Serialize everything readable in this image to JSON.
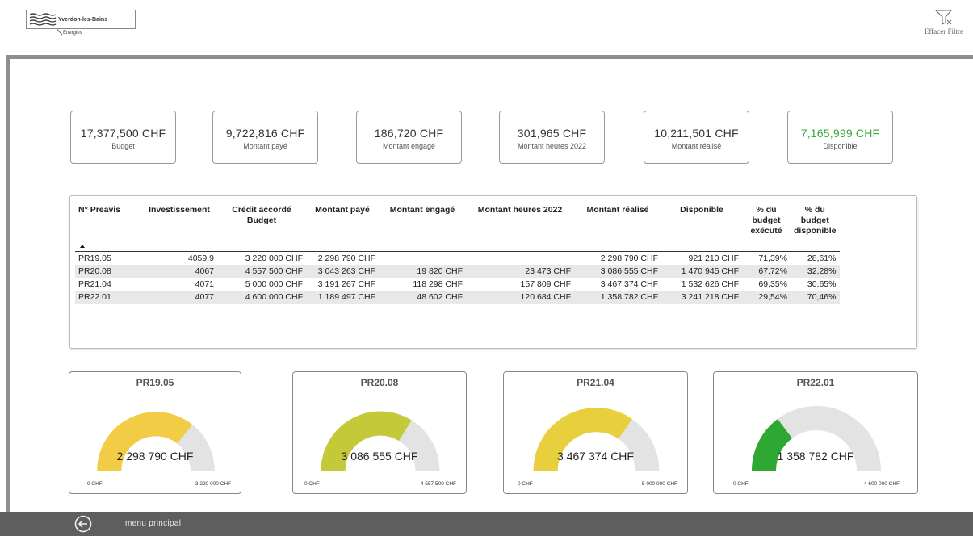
{
  "header": {
    "logo_name": "Yverdon-les-Bains",
    "logo_sub": "Énergies",
    "clear_filter_label": "Effacer Filtre"
  },
  "cards": [
    {
      "value": "17,377,500 CHF",
      "label": "Budget"
    },
    {
      "value": "9,722,816 CHF",
      "label": "Montant payé"
    },
    {
      "value": "186,720 CHF",
      "label": "Montant engagé"
    },
    {
      "value": "301,965 CHF",
      "label": "Montant heures 2022"
    },
    {
      "value": "10,211,501 CHF",
      "label": "Montant réalisé"
    },
    {
      "value": "7,165,999 CHF",
      "label": "Disponible"
    }
  ],
  "table": {
    "headers": [
      "N° Preavis",
      "Investissement",
      "Crédit accordé Budget",
      "Montant payé",
      "Montant engagé",
      "Montant heures 2022",
      "Montant réalisé",
      "Disponible",
      "% du budget exécuté",
      "% du budget disponible"
    ],
    "rows": [
      [
        "PR19.05",
        "4059.9",
        "3 220 000 CHF",
        "2 298 790 CHF",
        "",
        "",
        "2 298 790 CHF",
        "921 210 CHF",
        "71,39%",
        "28,61%"
      ],
      [
        "PR20.08",
        "4067",
        "4 557 500 CHF",
        "3 043 263 CHF",
        "19 820 CHF",
        "23 473 CHF",
        "3 086 555 CHF",
        "1 470 945 CHF",
        "67,72%",
        "32,28%"
      ],
      [
        "PR21.04",
        "4071",
        "5 000 000 CHF",
        "3 191 267 CHF",
        "118 298 CHF",
        "157 809 CHF",
        "3 467 374 CHF",
        "1 532 626 CHF",
        "69,35%",
        "30,65%"
      ],
      [
        "PR22.01",
        "4077",
        "4 600 000 CHF",
        "1 189 497 CHF",
        "48 602 CHF",
        "120 684 CHF",
        "1 358 782 CHF",
        "3 241 218 CHF",
        "29,54%",
        "70,46%"
      ]
    ]
  },
  "gauges": [
    {
      "title": "PR19.05",
      "value": "2 298 790 CHF",
      "min": "0 CHF",
      "max": "3 220 000 CHF",
      "fraction": 0.7139,
      "color": "#f2cc45"
    },
    {
      "title": "PR20.08",
      "value": "3 086 555 CHF",
      "min": "0 CHF",
      "max": "4 557 500 CHF",
      "fraction": 0.6772,
      "color": "#c4c93a"
    },
    {
      "title": "PR21.04",
      "value": "3 467 374 CHF",
      "min": "0 CHF",
      "max": "5 000 000 CHF",
      "fraction": 0.6935,
      "color": "#e8cf3e"
    },
    {
      "title": "PR22.01",
      "value": "1 358 782 CHF",
      "min": "0 CHF",
      "max": "4 600 000 CHF",
      "fraction": 0.2954,
      "color": "#2ea832"
    }
  ],
  "colors": {
    "gauge_track": "#e3e3e3",
    "frame": "#8e8e8e",
    "footer": "#5e5e5e",
    "disponible_accent": "#3aa63a"
  },
  "footer": {
    "back_icon": "arrow-left-circle-icon",
    "label": "menu principal"
  }
}
